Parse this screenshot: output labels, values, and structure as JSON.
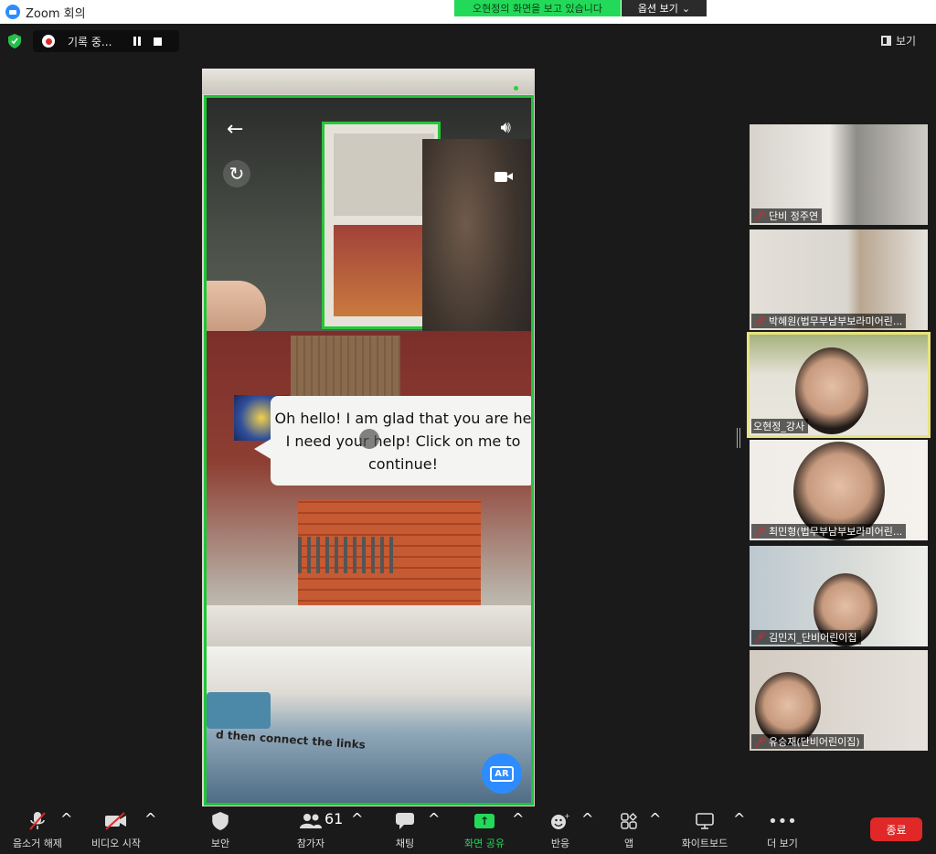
{
  "window": {
    "title": "Zoom 회의"
  },
  "banner": {
    "sharing_text": "오현정의 화면을 보고 있습니다",
    "options_label": "옵션 보기"
  },
  "recording": {
    "label": "기록 중..."
  },
  "view": {
    "label": "보기"
  },
  "shared_app": {
    "speech_text_line1": "Oh hello! I am glad that you are he",
    "speech_text_line2": "I need your help! Click on me to",
    "speech_text_line3": "continue!",
    "ar_label": "AR",
    "box_text": "d then connect the links"
  },
  "participants": [
    {
      "name": "단비 정주연",
      "muted": true,
      "active": false
    },
    {
      "name": "박혜원(법무부남부보라미어린...",
      "muted": true,
      "active": false
    },
    {
      "name": "오현정_강사",
      "muted": false,
      "active": true
    },
    {
      "name": "최민형(법무부남부보라미어린...",
      "muted": true,
      "active": false
    },
    {
      "name": "김민지_단비어린이집",
      "muted": true,
      "active": false
    },
    {
      "name": "유승재(단비어린이집)",
      "muted": true,
      "active": false
    }
  ],
  "toolbar": {
    "unmute": "음소거 해제",
    "start_video": "비디오 시작",
    "security": "보안",
    "participants": "참가자",
    "participants_count": "61",
    "chat": "채팅",
    "share_screen": "화면 공유",
    "reactions": "반응",
    "apps": "앱",
    "whiteboard": "화이트보드",
    "more": "더 보기",
    "end": "종료"
  },
  "colors": {
    "accent_green": "#23d959",
    "frame_green": "#22c33a",
    "end_red": "#e02828",
    "zoom_blue": "#2d8cff",
    "active_speaker": "#e7e37d"
  }
}
